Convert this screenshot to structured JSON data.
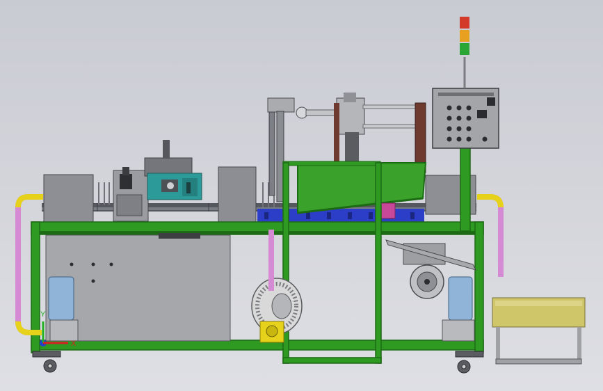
{
  "view": {
    "background": "#d3d4da",
    "frame_color": "#2f9a22",
    "frame_dark": "#1c6b14",
    "panel_color": "#8f9196",
    "guard_color": "#3aa12a",
    "tube_color": "#d58bd3",
    "elbow_color": "#e6d21a",
    "conveyor_color": "#2c3ec7",
    "tank_color": "#a6a7ab",
    "bin_color": "#cfc66a"
  },
  "signal_tower": {
    "colors": [
      "#d33a2a",
      "#e8a020",
      "#2aa637"
    ]
  },
  "triad": {
    "x_label": "X",
    "y_label": "Y",
    "x_color": "#d92020",
    "y_color": "#22b022",
    "z_color": "#2040d0"
  }
}
